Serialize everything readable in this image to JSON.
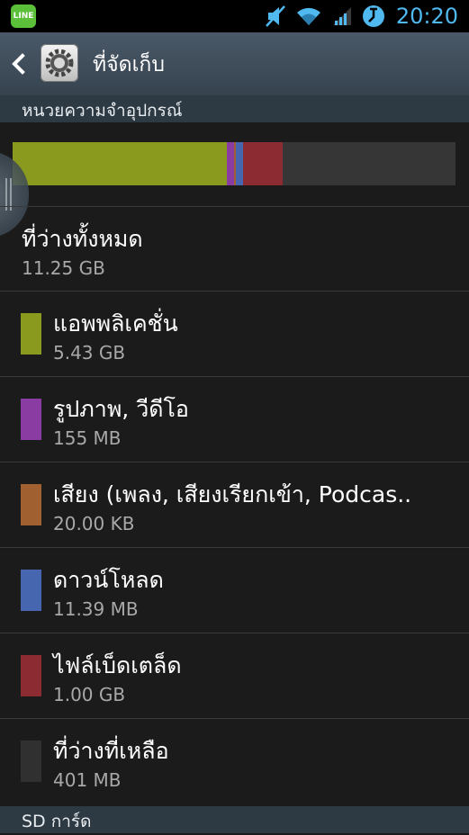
{
  "status_bar": {
    "app_icon_text": "LINE",
    "time": "20:20",
    "icons": [
      "line-app-icon",
      "mute-icon",
      "wifi-icon",
      "signal-icon",
      "sync-icon"
    ]
  },
  "action_bar": {
    "title": "ที่จัดเก็บ",
    "back_icon": "chevron-left-icon",
    "settings_icon": "gear-icon"
  },
  "device_section": {
    "header": "หนวยความจำอุปกรณ์",
    "usage_bar": {
      "segments": [
        {
          "name": "แอพพลิเคชั่น",
          "color": "#8a9a1f",
          "fraction": 0.484
        },
        {
          "name": "รูปภาพ, วีดีโอ",
          "color": "#8a3ca3",
          "fraction": 0.016
        },
        {
          "name": "เสียง",
          "color": "#a06030",
          "fraction": 0.004
        },
        {
          "name": "ดาวน์โหลด",
          "color": "#4666b0",
          "fraction": 0.016
        },
        {
          "name": "ไฟล์เบ็ดเตล็ด",
          "color": "#8c2c32",
          "fraction": 0.09
        },
        {
          "name": "ที่ว่างที่เหลือ",
          "color": "#363636",
          "fraction": 0.39
        }
      ]
    },
    "total": {
      "title": "ที่ว่างทั้งหมด",
      "value": "11.25 GB"
    },
    "items": [
      {
        "title": "แอพพลิเคชั่น",
        "value": "5.43 GB",
        "color": "#8a9a1f"
      },
      {
        "title": "รูปภาพ, วีดีโอ",
        "value": "155 MB",
        "color": "#8a3ca3"
      },
      {
        "title": "เสียง (เพลง, เสียงเรียกเข้า, Podcas..",
        "value": "20.00 KB",
        "color": "#a06030"
      },
      {
        "title": "ดาวน์โหลด",
        "value": "11.39 MB",
        "color": "#4666b0"
      },
      {
        "title": "ไฟล์เบ็ดเตล็ด",
        "value": "1.00 GB",
        "color": "#8c2c32"
      },
      {
        "title": "ที่ว่างที่เหลือ",
        "value": "401 MB",
        "color": "#303030"
      }
    ]
  },
  "sd_section": {
    "header": "SD การ์ด"
  }
}
